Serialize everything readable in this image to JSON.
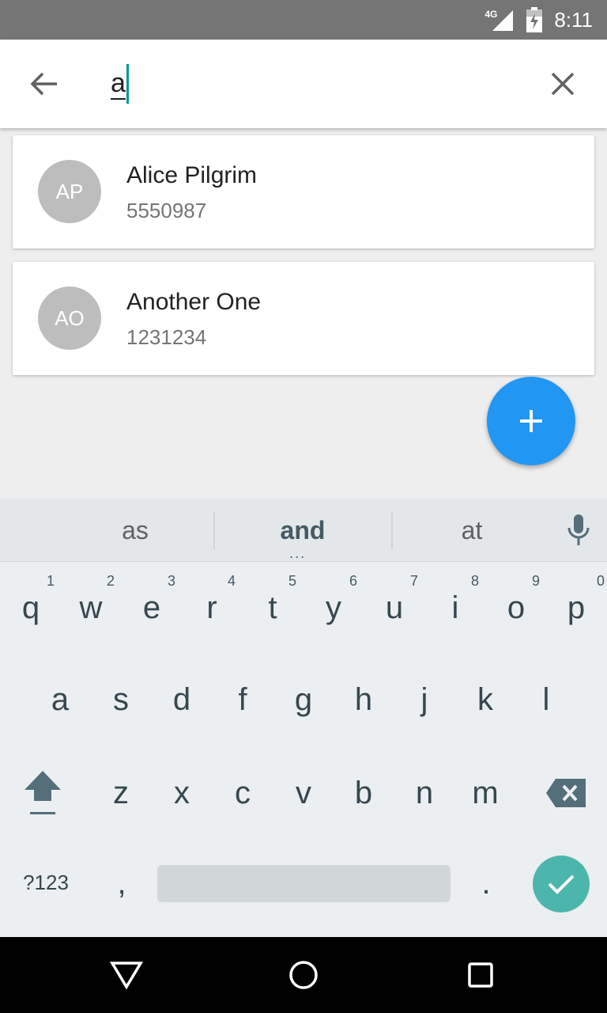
{
  "status_bar": {
    "network": "4G",
    "time": "8:11",
    "icons": [
      "signal-icon",
      "battery-icon"
    ]
  },
  "search": {
    "back_icon": "arrow-back-icon",
    "query": "a",
    "clear_icon": "close-icon"
  },
  "contacts": [
    {
      "initials": "AP",
      "name": "Alice Pilgrim",
      "phone": "5550987"
    },
    {
      "initials": "AO",
      "name": "Another One",
      "phone": "1231234"
    }
  ],
  "fab": {
    "icon": "add-icon",
    "color": "#2196f3"
  },
  "keyboard": {
    "suggestions": [
      "as",
      "and",
      "at"
    ],
    "suggestion_more": "...",
    "mic_icon": "mic-icon",
    "row1": [
      "q",
      "w",
      "e",
      "r",
      "t",
      "y",
      "u",
      "i",
      "o",
      "p"
    ],
    "row1_hints": [
      "1",
      "2",
      "3",
      "4",
      "5",
      "6",
      "7",
      "8",
      "9",
      "0"
    ],
    "row2": [
      "a",
      "s",
      "d",
      "f",
      "g",
      "h",
      "j",
      "k",
      "l"
    ],
    "row3": [
      "z",
      "x",
      "c",
      "v",
      "b",
      "n",
      "m"
    ],
    "shift_icon": "shift-icon",
    "backspace_icon": "backspace-icon",
    "symbols_label": "?123",
    "comma": ",",
    "period": ".",
    "enter_icon": "check-icon",
    "enter_color": "#4db6ac"
  },
  "nav_bar": {
    "icons": [
      "back-triangle-icon",
      "home-circle-icon",
      "recents-square-icon"
    ]
  }
}
